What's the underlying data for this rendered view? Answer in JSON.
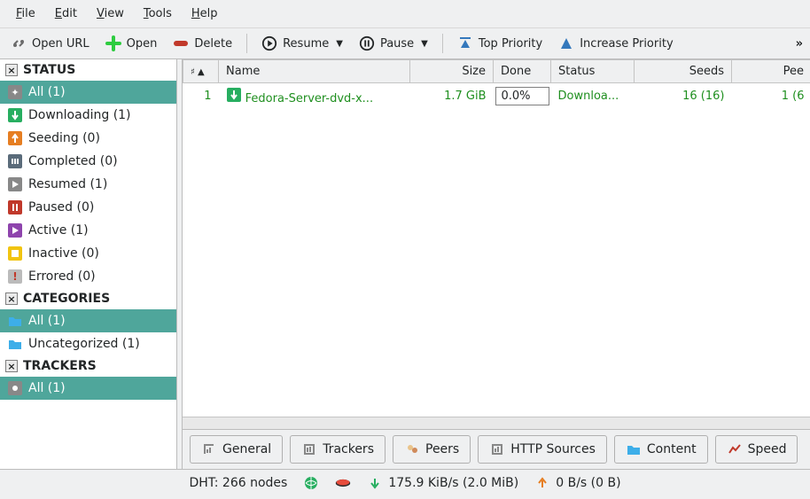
{
  "menubar": [
    "File",
    "Edit",
    "View",
    "Tools",
    "Help"
  ],
  "toolbar": {
    "open_url": "Open URL",
    "open": "Open",
    "delete": "Delete",
    "resume": "Resume",
    "pause": "Pause",
    "top_priority": "Top Priority",
    "increase_priority": "Increase Priority"
  },
  "sidebar": {
    "groups": [
      {
        "title": "STATUS",
        "items": [
          {
            "label": "All (1)",
            "icon": "all",
            "selected": true
          },
          {
            "label": "Downloading (1)",
            "icon": "download"
          },
          {
            "label": "Seeding (0)",
            "icon": "seed"
          },
          {
            "label": "Completed (0)",
            "icon": "complete"
          },
          {
            "label": "Resumed (1)",
            "icon": "resume"
          },
          {
            "label": "Paused (0)",
            "icon": "pause"
          },
          {
            "label": "Active (1)",
            "icon": "active"
          },
          {
            "label": "Inactive (0)",
            "icon": "inactive"
          },
          {
            "label": "Errored (0)",
            "icon": "error"
          }
        ]
      },
      {
        "title": "CATEGORIES",
        "items": [
          {
            "label": "All (1)",
            "icon": "folder",
            "selected": true
          },
          {
            "label": "Uncategorized (1)",
            "icon": "folder"
          }
        ]
      },
      {
        "title": "TRACKERS",
        "items": [
          {
            "label": "All (1)",
            "icon": "tracker",
            "selected": true
          }
        ]
      }
    ]
  },
  "table": {
    "columns": [
      "#",
      "Name",
      "Size",
      "Done",
      "Status",
      "Seeds",
      "Pee"
    ],
    "rows": [
      {
        "num": "1",
        "name": "Fedora-Server-dvd-x...",
        "size": "1.7 GiB",
        "done": "0.0%",
        "status": "Downloa...",
        "seeds": "16 (16)",
        "peers": "1 (6"
      }
    ]
  },
  "tabs": [
    "General",
    "Trackers",
    "Peers",
    "HTTP Sources",
    "Content",
    "Speed"
  ],
  "statusbar": {
    "dht": "DHT: 266 nodes",
    "down": "175.9 KiB/s (2.0 MiB)",
    "up": "0 B/s (0 B)"
  }
}
